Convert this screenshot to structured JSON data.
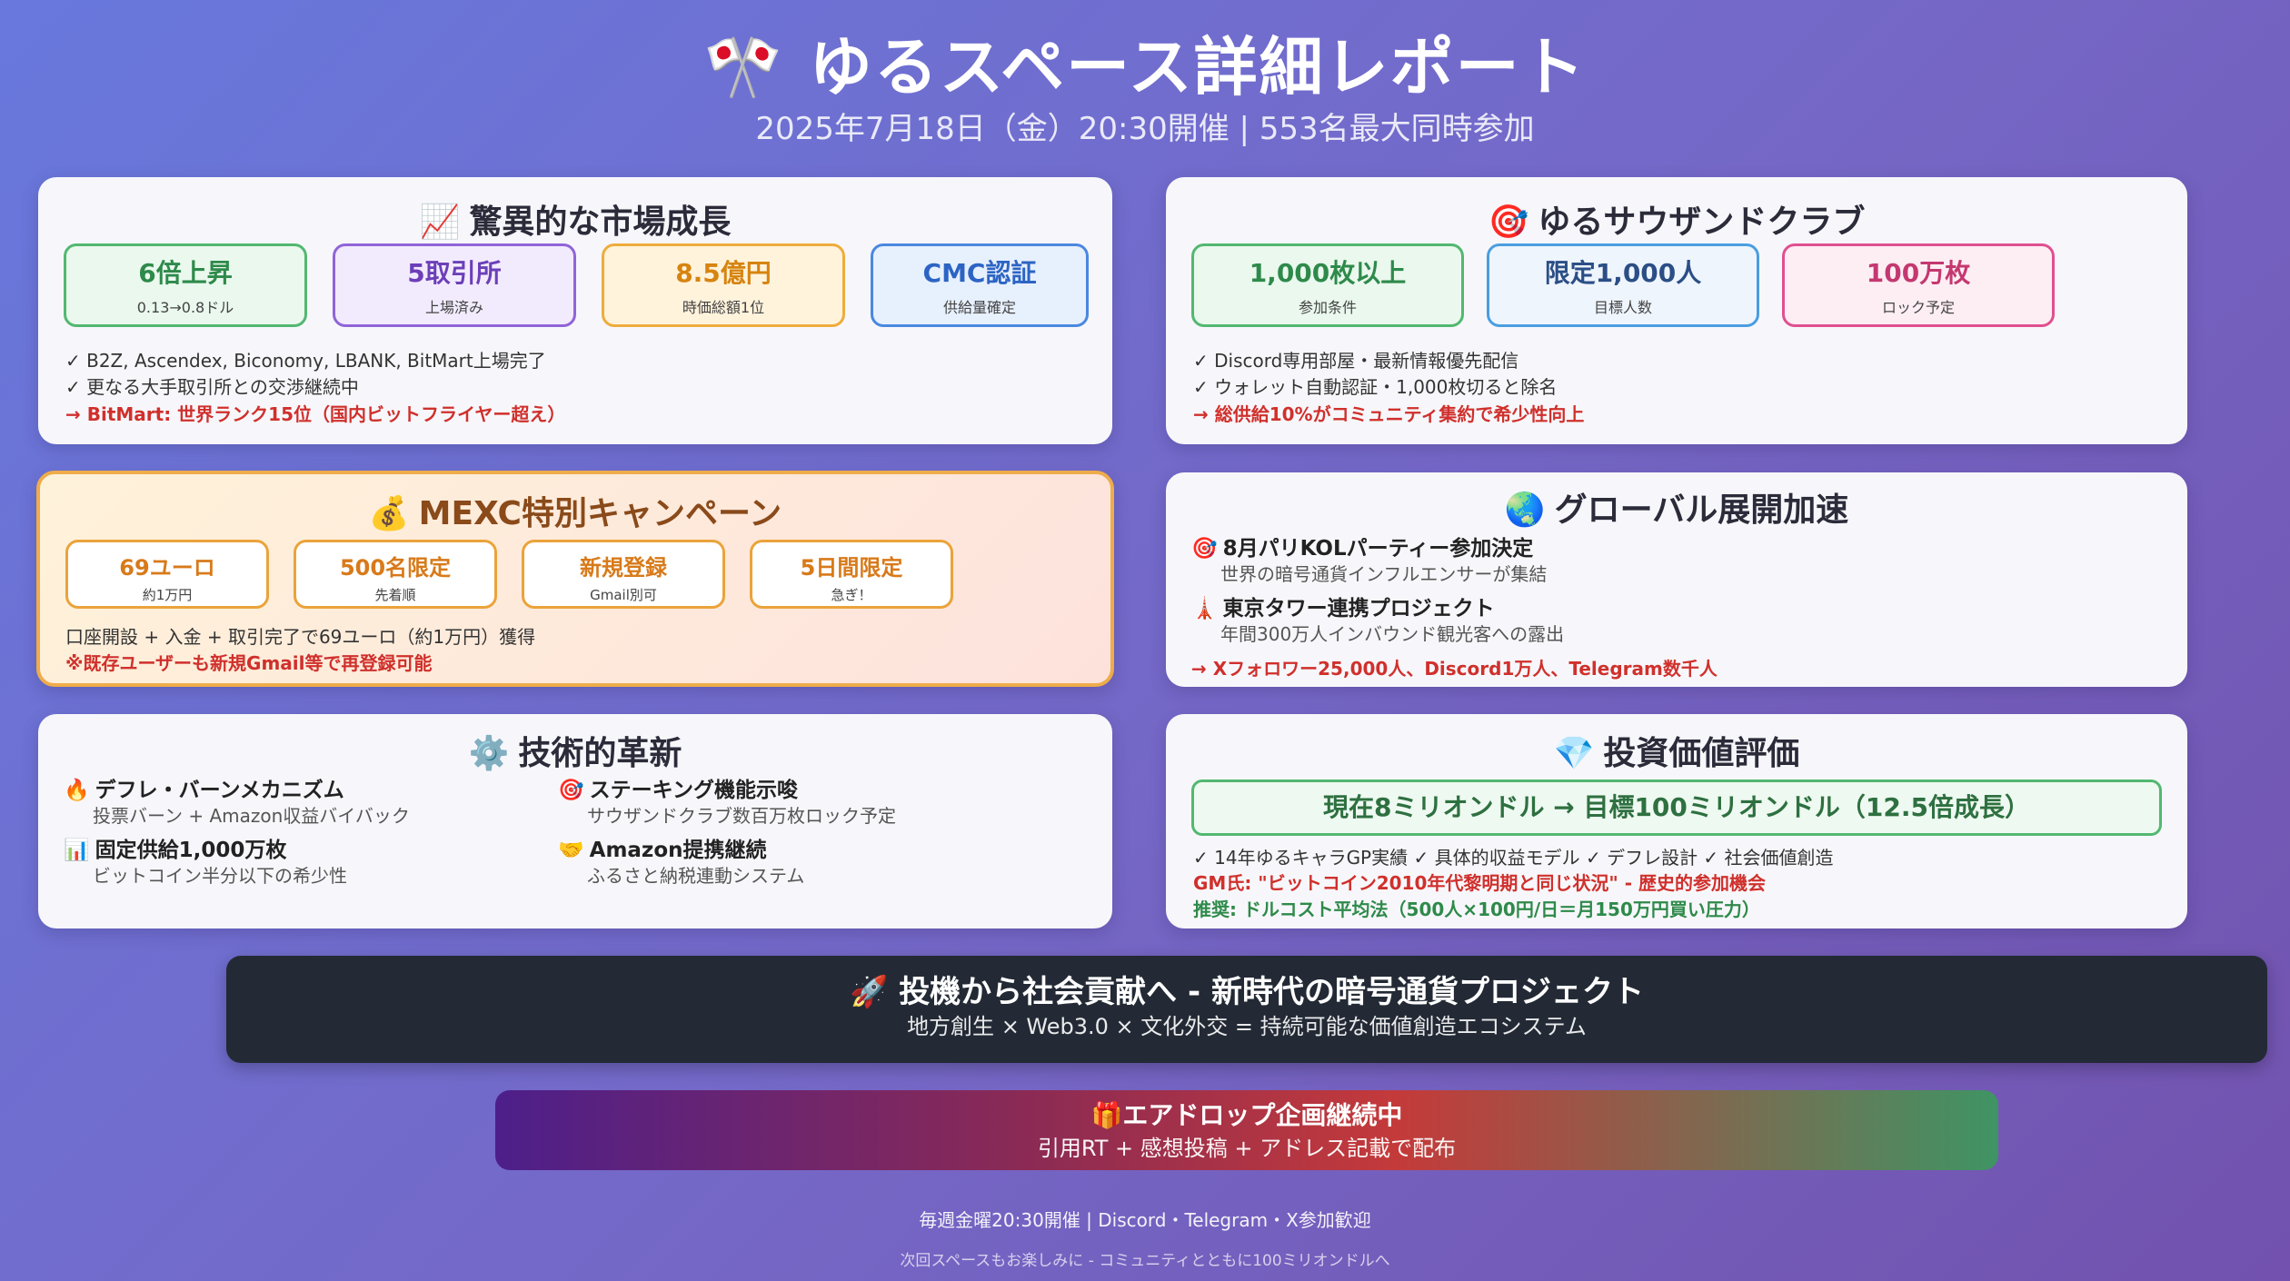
{
  "header": {
    "icon": "🎌",
    "title": "ゆるスペース詳細レポート",
    "subtitle": "2025年7月18日（金）20:30開催 | 553名最大同時参加"
  },
  "market": {
    "icon": "📈",
    "title": "驚異的な市場成長",
    "stats": [
      {
        "big": "6倍上昇",
        "small": "0.13→0.8ドル"
      },
      {
        "big": "5取引所",
        "small": "上場済み"
      },
      {
        "big": "8.5億円",
        "small": "時価総額1位"
      },
      {
        "big": "CMC認証",
        "small": "供給量確定"
      }
    ],
    "lines": [
      "✓ B2Z, Ascendex, Biconomy, LBANK, BitMart上場完了",
      "✓ 更なる大手取引所との交渉継続中"
    ],
    "highlight": "→ BitMart: 世界ランク15位（国内ビットフライヤー超え）"
  },
  "club": {
    "icon": "🎯",
    "title": "ゆるサウザンドクラブ",
    "stats": [
      {
        "big": "1,000枚以上",
        "small": "参加条件"
      },
      {
        "big": "限定1,000人",
        "small": "目標人数"
      },
      {
        "big": "100万枚",
        "small": "ロック予定"
      }
    ],
    "lines": [
      "✓ Discord専用部屋・最新情報優先配信",
      "✓ ウォレット自動認証・1,000枚切ると除名"
    ],
    "highlight": "→ 総供給10%がコミュニティ集約で希少性向上"
  },
  "mexc": {
    "icon": "💰",
    "title": "MEXC特別キャンペーン",
    "stats": [
      {
        "big": "69ユーロ",
        "small": "約1万円"
      },
      {
        "big": "500名限定",
        "small": "先着順"
      },
      {
        "big": "新規登録",
        "small": "Gmail別可"
      },
      {
        "big": "5日間限定",
        "small": "急ぎ！"
      }
    ],
    "line": "口座開設 + 入金 + 取引完了で69ユーロ（約1万円）獲得",
    "highlight": "※既存ユーザーも新規Gmail等で再登録可能"
  },
  "global": {
    "icon": "🌏",
    "title": "グローバル展開加速",
    "items": [
      {
        "icon": "🎯",
        "title": "8月パリKOLパーティー参加決定",
        "sub": "世界の暗号通貨インフルエンサーが集結"
      },
      {
        "icon": "🗼",
        "title": "東京タワー連携プロジェクト",
        "sub": "年間300万人インバウンド観光客への露出"
      }
    ],
    "highlight": "→ Xフォロワー25,000人、Discord1万人、Telegram数千人"
  },
  "tech": {
    "icon": "⚙️",
    "title": "技術的革新",
    "items": [
      {
        "icon": "🔥",
        "title": "デフレ・バーンメカニズム",
        "sub": "投票バーン + Amazon収益バイバック"
      },
      {
        "icon": "🎯",
        "title": "ステーキング機能示唆",
        "sub": "サウザンドクラブ数百万枚ロック予定"
      },
      {
        "icon": "📊",
        "title": "固定供給1,000万枚",
        "sub": "ビットコイン半分以下の希少性"
      },
      {
        "icon": "🤝",
        "title": "Amazon提携継続",
        "sub": "ふるさと納税連動システム"
      }
    ]
  },
  "invest": {
    "icon": "💎",
    "title": "投資価値評価",
    "goal": "現在8ミリオンドル → 目標100ミリオンドル（12.5倍成長）",
    "line": "✓ 14年ゆるキャラGP実績 ✓ 具体的収益モデル ✓ デフレ設計 ✓ 社会価値創造",
    "quote": "GM氏: \"ビットコイン2010年代黎明期と同じ状況\" - 歴史的参加機会",
    "recommend": "推奨: ドルコスト平均法（500人×100円/日＝月150万円買い圧力）"
  },
  "mission": {
    "icon": "🚀",
    "title": "投機から社会貢献へ - 新時代の暗号通貨プロジェクト",
    "sub": "地方創生 × Web3.0 × 文化外交 = 持続可能な価値創造エコシステム"
  },
  "airdrop": {
    "icon": "🎁",
    "title": "エアドロップ企画継続中",
    "sub": "引用RT + 感想投稿 + アドレス記載で配布"
  },
  "footer": {
    "line1": "毎週金曜20:30開催 | Discord・Telegram・X参加歓迎",
    "line2": "次回スペースもお楽しみに - コミュニティとともに100ミリオンドルへ"
  }
}
